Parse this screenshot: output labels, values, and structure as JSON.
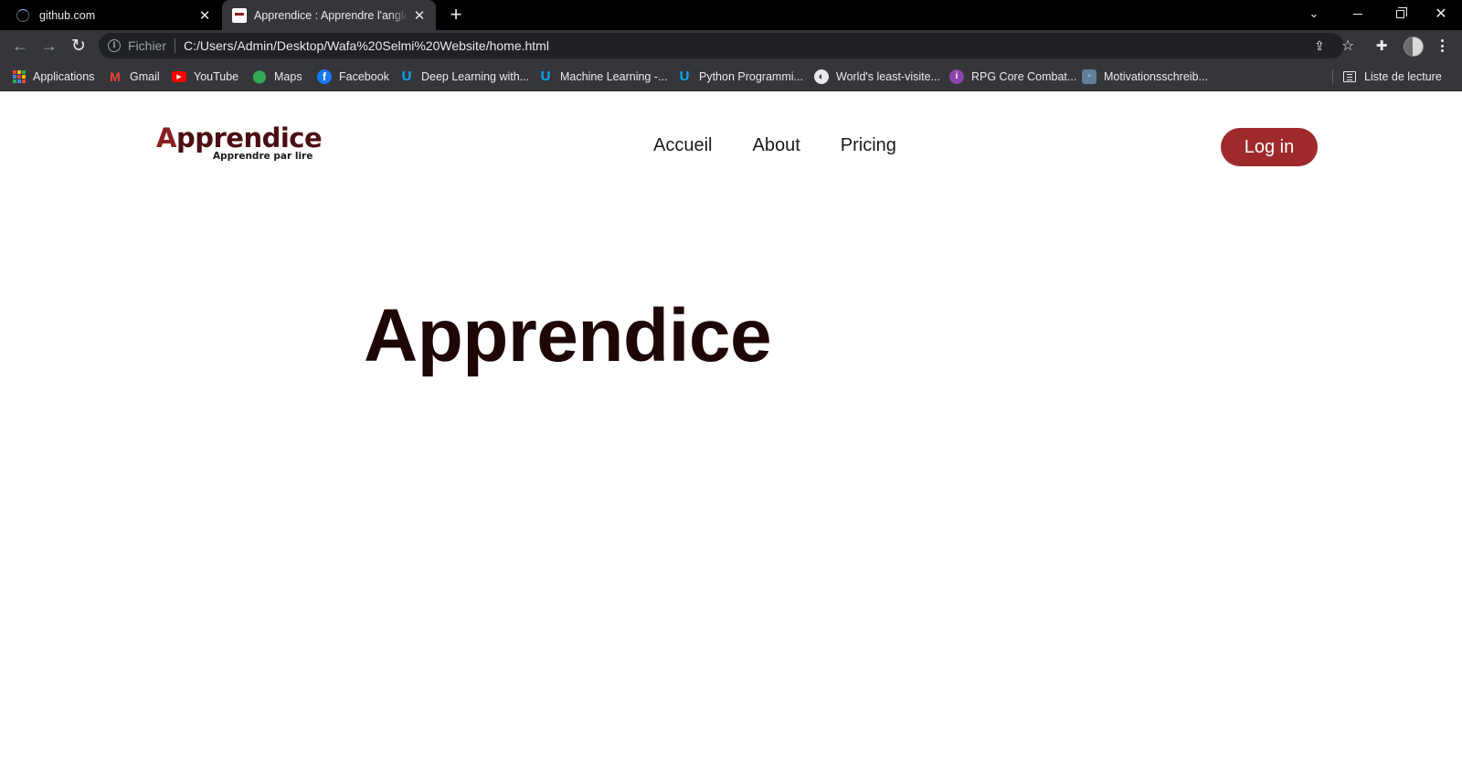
{
  "browser": {
    "tabs": [
      {
        "title": "github.com",
        "state": "loading"
      },
      {
        "title": "Apprendice : Apprendre l'anglais",
        "state": "active"
      }
    ],
    "new_tab_symbol": "+",
    "omnibox": {
      "scheme_label": "Fichier",
      "url": "C:/Users/Admin/Desktop/Wafa%20Selmi%20Website/home.html"
    },
    "bookmarks": [
      {
        "label": "Applications",
        "icon": "apps-grid-icon"
      },
      {
        "label": "Gmail",
        "icon": "gmail-icon"
      },
      {
        "label": "YouTube",
        "icon": "youtube-icon"
      },
      {
        "label": "Maps",
        "icon": "maps-pin-icon"
      },
      {
        "label": "Facebook",
        "icon": "facebook-icon"
      },
      {
        "label": "Deep Learning with...",
        "icon": "udemy-icon"
      },
      {
        "label": "Machine Learning -...",
        "icon": "udemy-icon"
      },
      {
        "label": "Python Programmi...",
        "icon": "udemy-icon"
      },
      {
        "label": "World's least-visite...",
        "icon": "globe-icon"
      },
      {
        "label": "RPG Core Combat...",
        "icon": "rpg-icon"
      },
      {
        "label": "Motivationsschreib...",
        "icon": "document-icon"
      }
    ],
    "reading_list_label": "Liste de lecture",
    "colors": {
      "tabbar": "#000000",
      "toolbar": "#35363a",
      "omnibox": "#202124"
    }
  },
  "site": {
    "logo": {
      "wordmark": "Apprendice",
      "tagline": "Apprendre par lire"
    },
    "nav": [
      "Accueil",
      "About",
      "Pricing"
    ],
    "login_label": "Log in",
    "hero_title": "Apprendice",
    "colors": {
      "brand": "#9e2a2b",
      "logo": "#4a0f12",
      "hero_text": "#1e0607"
    }
  }
}
